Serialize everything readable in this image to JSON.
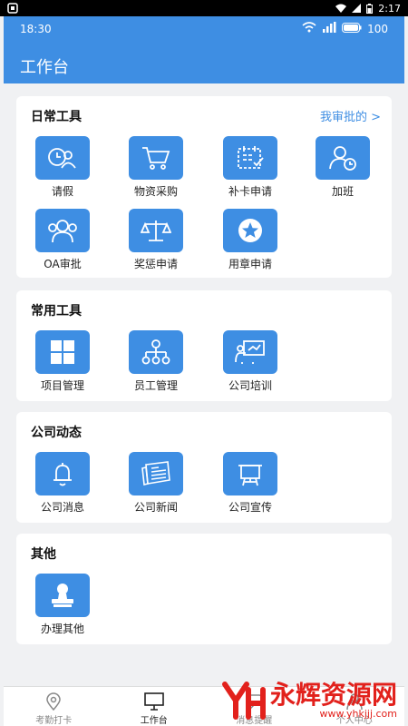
{
  "system": {
    "time": "2:17"
  },
  "status": {
    "time": "18:30",
    "battery": "100"
  },
  "header": {
    "title": "工作台"
  },
  "daily": {
    "title": "日常工具",
    "link": "我审批的 >",
    "items": [
      {
        "label": "请假",
        "icon": "leave-icon"
      },
      {
        "label": "物资采购",
        "icon": "cart-icon"
      },
      {
        "label": "补卡申请",
        "icon": "calendar-check-icon"
      },
      {
        "label": "加班",
        "icon": "user-clock-icon"
      },
      {
        "label": "OA审批",
        "icon": "group-icon"
      },
      {
        "label": "奖惩申请",
        "icon": "scale-icon"
      },
      {
        "label": "用章申请",
        "icon": "star-badge-icon"
      }
    ]
  },
  "common": {
    "title": "常用工具",
    "items": [
      {
        "label": "项目管理",
        "icon": "grid-icon"
      },
      {
        "label": "员工管理",
        "icon": "org-chart-icon"
      },
      {
        "label": "公司培训",
        "icon": "training-icon"
      }
    ]
  },
  "news": {
    "title": "公司动态",
    "items": [
      {
        "label": "公司消息",
        "icon": "bell-icon"
      },
      {
        "label": "公司新闻",
        "icon": "newspaper-icon"
      },
      {
        "label": "公司宣传",
        "icon": "billboard-icon"
      }
    ]
  },
  "other": {
    "title": "其他",
    "items": [
      {
        "label": "办理其他",
        "icon": "stamp-icon"
      }
    ]
  },
  "tabs": [
    {
      "label": "考勤打卡",
      "icon": "location-icon"
    },
    {
      "label": "工作台",
      "icon": "monitor-icon"
    },
    {
      "label": "消息提醒",
      "icon": "message-icon"
    },
    {
      "label": "个人中心",
      "icon": "person-icon"
    }
  ],
  "watermark": {
    "text": "永辉资源网",
    "url": "www.yhkjjj.com"
  },
  "colors": {
    "primary": "#3e8ee3",
    "background": "#f0f1f3",
    "watermark": "#e2211c"
  }
}
